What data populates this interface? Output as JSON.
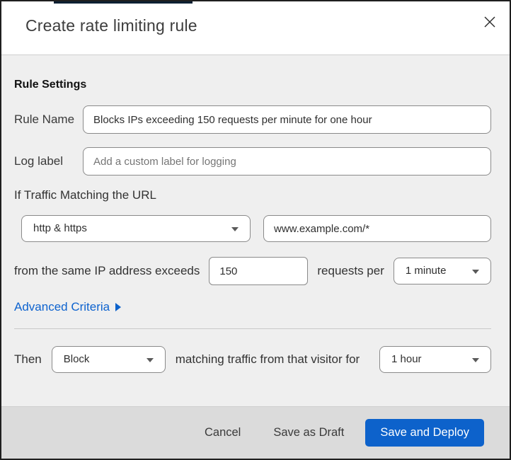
{
  "header": {
    "title": "Create rate limiting rule"
  },
  "section": {
    "heading": "Rule Settings"
  },
  "fields": {
    "rule_name": {
      "label": "Rule Name",
      "value": "Blocks IPs exceeding 150 requests per minute for one hour"
    },
    "log_label": {
      "label": "Log label",
      "placeholder": "Add a custom label for logging"
    },
    "traffic_match": {
      "intro": "If Traffic Matching the URL",
      "scheme": "http & https",
      "url": "www.example.com/*"
    },
    "threshold": {
      "prefix": "from the same IP address exceeds",
      "requests": "150",
      "middle": "requests per",
      "period": "1 minute"
    },
    "advanced_criteria": {
      "label": "Advanced Criteria"
    },
    "then": {
      "label": "Then",
      "action": "Block",
      "middle": "matching traffic from that visitor for",
      "duration": "1 hour"
    }
  },
  "footer": {
    "cancel": "Cancel",
    "save_draft": "Save as Draft",
    "save_deploy": "Save and Deploy"
  },
  "colors": {
    "accent_blue": "#0d62cb",
    "link_blue": "#0e63cf",
    "top_strip": "#0c2033",
    "body_bg": "#efefef",
    "footer_bg": "#dbdbdb"
  }
}
